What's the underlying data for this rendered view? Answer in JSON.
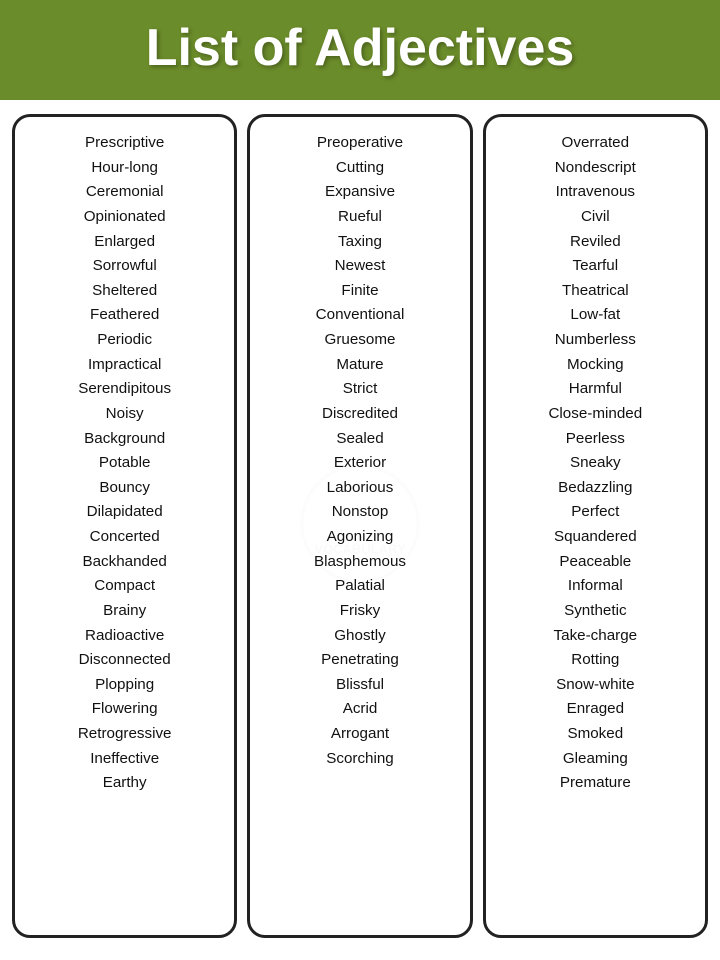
{
  "header": {
    "title": "List of Adjectives",
    "bg_color": "#6b8c2a"
  },
  "columns": [
    {
      "id": "col1",
      "words": [
        "Prescriptive",
        "Hour-long",
        "Ceremonial",
        "Opinionated",
        "Enlarged",
        "Sorrowful",
        "Sheltered",
        "Feathered",
        "Periodic",
        "Impractical",
        "Serendipitous",
        "Noisy",
        "Background",
        "Potable",
        "Bouncy",
        "Dilapidated",
        "Concerted",
        "Backhanded",
        "Compact",
        "Brainy",
        "Radioactive",
        "Disconnected",
        "Plopping",
        "Flowering",
        "Retrogressive",
        "Ineffective",
        "Earthy"
      ]
    },
    {
      "id": "col2",
      "words": [
        "Preoperative",
        "Cutting",
        "Expansive",
        "Rueful",
        "Taxing",
        "Newest",
        "Finite",
        "Conventional",
        "Gruesome",
        "Mature",
        "Strict",
        "Discredited",
        "Sealed",
        "Exterior",
        "Laborious",
        "Nonstop",
        "Agonizing",
        "Blasphemous",
        "Palatial",
        "Frisky",
        "Ghostly",
        "Penetrating",
        "Blissful",
        "Acrid",
        "Arrogant",
        "Scorching"
      ]
    },
    {
      "id": "col3",
      "words": [
        "Overrated",
        "Nondescript",
        "Intravenous",
        "Civil",
        "Reviled",
        "Tearful",
        "Theatrical",
        "Low-fat",
        "Numberless",
        "Mocking",
        "Harmful",
        "Close-minded",
        "Peerless",
        "Sneaky",
        "Bedazzling",
        "Perfect",
        "Squandered",
        "Peaceable",
        "Informal",
        "Synthetic",
        "Take-charge",
        "Rotting",
        "Snow-white",
        "Enraged",
        "Smoked",
        "Gleaming",
        "Premature"
      ]
    }
  ]
}
